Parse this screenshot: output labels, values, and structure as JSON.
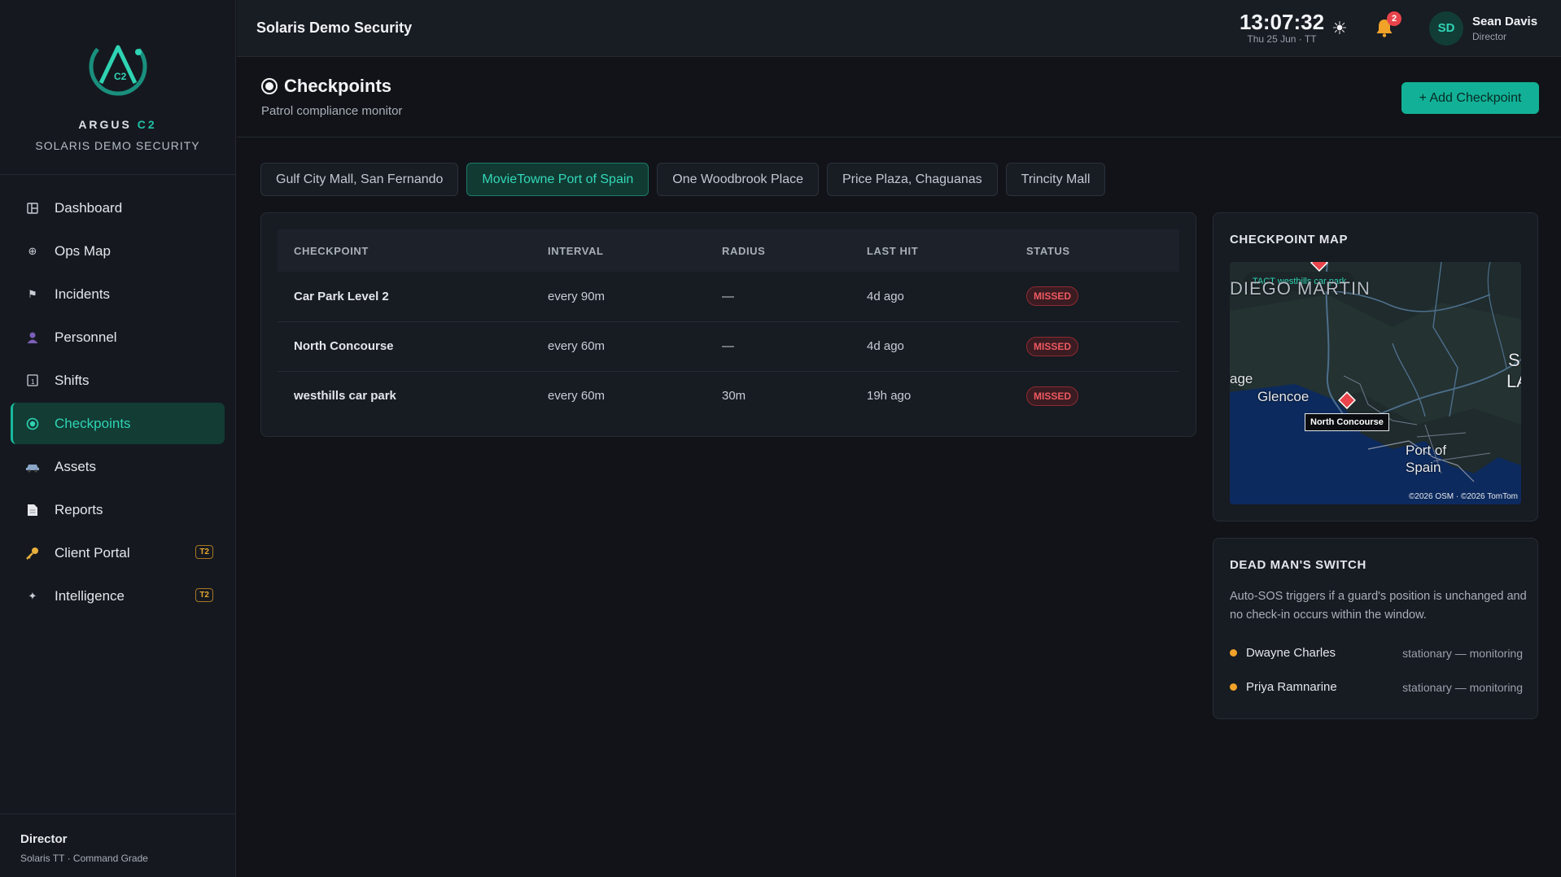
{
  "brand": {
    "name": "ARGUS",
    "name_accent": "C2",
    "logo_text": "C2",
    "subtitle": "SOLARIS DEMO SECURITY"
  },
  "sidebar": {
    "items": [
      {
        "label": "Dashboard",
        "icon": "grid-icon"
      },
      {
        "label": "Ops Map",
        "icon": "globe-icon"
      },
      {
        "label": "Incidents",
        "icon": "flag-icon"
      },
      {
        "label": "Personnel",
        "icon": "person-icon"
      },
      {
        "label": "Shifts",
        "icon": "calendar-icon"
      },
      {
        "label": "Checkpoints",
        "icon": "radio-icon",
        "active": true
      },
      {
        "label": "Assets",
        "icon": "vehicle-icon"
      },
      {
        "label": "Reports",
        "icon": "document-icon"
      },
      {
        "label": "Client Portal",
        "icon": "key-icon",
        "badge": "T2"
      },
      {
        "label": "Intelligence",
        "icon": "sparkle-icon",
        "badge": "T2"
      }
    ],
    "footer": {
      "role": "Director",
      "org": "Solaris TT · Command Grade"
    }
  },
  "topbar": {
    "title": "Solaris Demo Security",
    "time": "13:07:32",
    "date": "Thu 25 Jun · TT",
    "notifications": "2",
    "user": {
      "initials": "SD",
      "name": "Sean Davis",
      "role": "Director"
    }
  },
  "page": {
    "title": "Checkpoints",
    "subtitle": "Patrol compliance monitor",
    "add_label": "+ Add Checkpoint"
  },
  "sites": [
    {
      "label": "Gulf City Mall, San Fernando"
    },
    {
      "label": "MovieTowne Port of Spain",
      "active": true
    },
    {
      "label": "One Woodbrook Place"
    },
    {
      "label": "Price Plaza, Chaguanas"
    },
    {
      "label": "Trincity Mall"
    }
  ],
  "table": {
    "headers": [
      "CHECKPOINT",
      "INTERVAL",
      "RADIUS",
      "LAST HIT",
      "STATUS"
    ],
    "rows": [
      {
        "name": "Car Park Level 2",
        "interval": "every 90m",
        "radius": "—",
        "last_hit": "4d ago",
        "status": "MISSED"
      },
      {
        "name": "North Concourse",
        "interval": "every 60m",
        "radius": "—",
        "last_hit": "4d ago",
        "status": "MISSED"
      },
      {
        "name": "westhills car park",
        "interval": "every 60m",
        "radius": "30m",
        "last_hit": "19h ago",
        "status": "MISSED"
      }
    ]
  },
  "map": {
    "title": "CHECKPOINT MAP",
    "chip": "TACT westhills car park",
    "popup": "North Concourse",
    "labels": {
      "region": "DIEGO MARTIN",
      "glencoe": "Glencoe",
      "edge_left": "age",
      "port_of_spain_1": "Port of",
      "port_of_spain_2": "Spain",
      "edge_right_1": "S",
      "edge_right_2": "LA"
    },
    "attribution": "©2026 OSM · ©2026 TomTom"
  },
  "dms": {
    "title": "DEAD MAN'S SWITCH",
    "description": "Auto-SOS triggers if a guard's position is unchanged and no check-in occurs within the window.",
    "guards": [
      {
        "name": "Dwayne Charles",
        "state": "stationary — monitoring"
      },
      {
        "name": "Priya Ramnarine",
        "state": "stationary — monitoring"
      }
    ]
  },
  "colors": {
    "accent": "#12b197",
    "accent_text": "#2fd4b4",
    "missed": "#ef5960",
    "warning": "#f0a229",
    "background": "#111318",
    "panel": "#171b22"
  }
}
